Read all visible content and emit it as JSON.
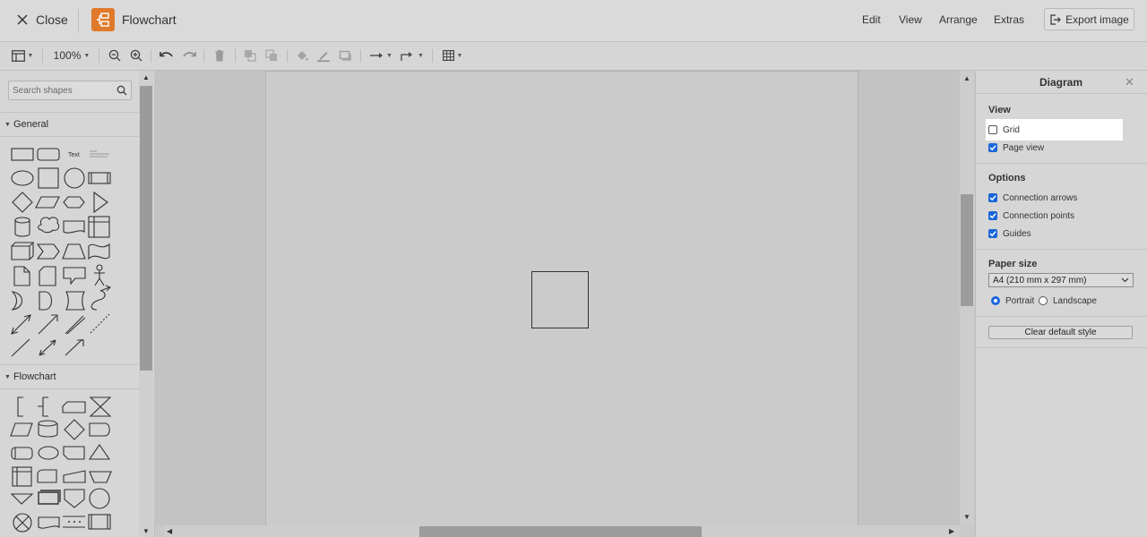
{
  "header": {
    "close_label": "Close",
    "app_title": "Flowchart",
    "menu": [
      "Edit",
      "View",
      "Arrange",
      "Extras"
    ],
    "export_label": "Export image",
    "logo_color": "#e07a2a"
  },
  "toolbar": {
    "zoom": "100%",
    "icons": [
      "format-panel-icon",
      "zoom-out-icon",
      "zoom-in-icon",
      "undo-icon",
      "redo-icon",
      "delete-icon",
      "to-front-icon",
      "to-back-icon",
      "fill-color-icon",
      "line-color-icon",
      "shadow-icon",
      "connection-icon",
      "waypoints-icon",
      "table-icon"
    ]
  },
  "left_panel": {
    "search_placeholder": "Search shapes",
    "sections": [
      {
        "title": "General"
      },
      {
        "title": "Flowchart"
      }
    ],
    "text_shape_label": "Text"
  },
  "right_panel": {
    "title": "Diagram",
    "view": {
      "heading": "View",
      "options": [
        {
          "label": "Grid",
          "checked": false
        },
        {
          "label": "Page view",
          "checked": true
        }
      ]
    },
    "options": {
      "heading": "Options",
      "items": [
        {
          "label": "Connection arrows",
          "checked": true
        },
        {
          "label": "Connection points",
          "checked": true
        },
        {
          "label": "Guides",
          "checked": true
        }
      ]
    },
    "paper_size": {
      "heading": "Paper size",
      "selected": "A4 (210 mm x 297 mm)",
      "orientation": [
        {
          "label": "Portrait",
          "selected": true
        },
        {
          "label": "Landscape",
          "selected": false
        }
      ]
    },
    "clear_default_style_label": "Clear default style"
  },
  "colors": {
    "accent": "#1a66d9",
    "background": "#c9c9c9"
  }
}
